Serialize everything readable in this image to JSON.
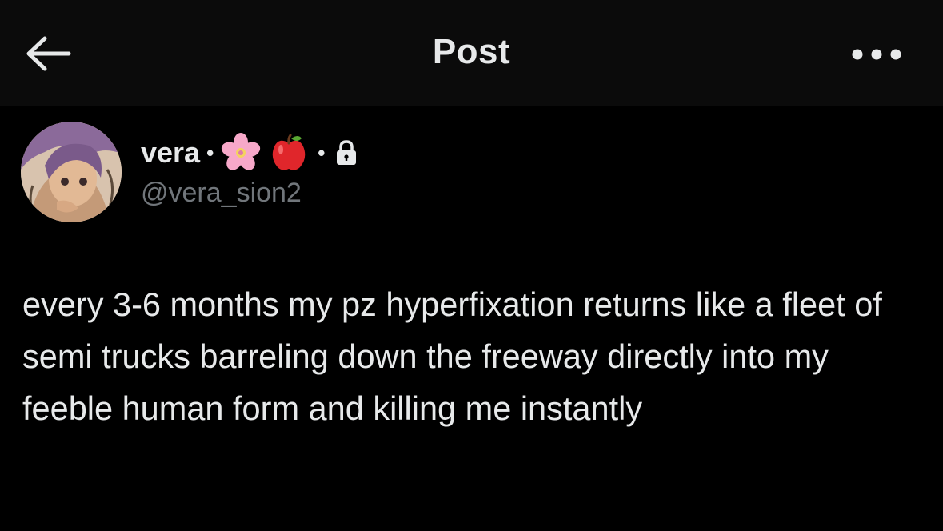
{
  "header": {
    "title": "Post",
    "back_icon": "arrow-left-icon",
    "more_icon": "more-horizontal-icon"
  },
  "author": {
    "display_name": "vera",
    "separator": "•",
    "emojis": [
      "cherry-blossom-emoji",
      "red-apple-emoji"
    ],
    "protected_icon": "lock-icon",
    "handle": "@vera_sion2"
  },
  "post": {
    "text": "every 3-6 months my pz hyperfixation returns like a fleet of semi trucks barreling down the freeway directly into my feeble human form and killing me instantly"
  },
  "colors": {
    "background": "#000000",
    "header_background": "#0b0b0b",
    "primary_text": "#e7e9ea",
    "secondary_text": "#71767b"
  }
}
